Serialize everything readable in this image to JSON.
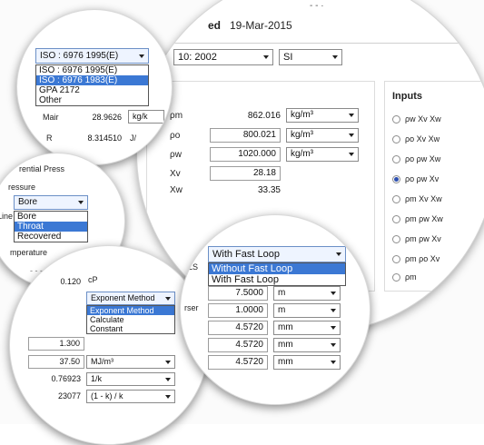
{
  "header": {
    "date_label": "ed",
    "date": "19-Mar-2015",
    "top_fragment": "- - ·"
  },
  "standard_select": {
    "value": "10: 2002"
  },
  "units_select": {
    "value": "SI"
  },
  "measurements": {
    "rows": [
      {
        "label": "ρm",
        "value": "862.016",
        "unit": "kg/m³"
      },
      {
        "label": "ρo",
        "value": "800.021",
        "unit": "kg/m³"
      },
      {
        "label": "ρw",
        "value": "1020.000",
        "unit": "kg/m³"
      },
      {
        "label": "Xv",
        "value": "28.18"
      },
      {
        "label": "Xw",
        "value": "33.35"
      }
    ]
  },
  "inputs": {
    "title": "Inputs",
    "options": [
      {
        "label": "ρw Xv Xw",
        "selected": false
      },
      {
        "label": "ρo Xv Xw",
        "selected": false
      },
      {
        "label": "ρo ρw Xw",
        "selected": false
      },
      {
        "label": "ρo ρw Xv",
        "selected": true
      },
      {
        "label": "ρm Xv Xw",
        "selected": false
      },
      {
        "label": "ρm ρw Xw",
        "selected": false
      },
      {
        "label": "ρm ρw Xv",
        "selected": false
      },
      {
        "label": "ρm ρo Xv",
        "selected": false
      },
      {
        "label": "ρm",
        "selected": false
      }
    ]
  },
  "iso_zoom": {
    "selected": "ISO : 6976 1995(E)",
    "options": [
      {
        "label": "ISO : 6976 1995(E)",
        "highlighted": false
      },
      {
        "label": "ISO : 6976 1983(E)",
        "highlighted": true
      },
      {
        "label": "GPA 2172",
        "highlighted": false
      },
      {
        "label": "Other",
        "highlighted": false
      }
    ],
    "rows": [
      {
        "label": "Mair",
        "value": "28.9626",
        "unit": "kg/k"
      },
      {
        "label": "R",
        "value": "8.314510",
        "unit": "J/"
      }
    ]
  },
  "pressure_zoom": {
    "header": "rential Press",
    "pressure_label": "ressure",
    "selected": "Bore",
    "line_label": "Line",
    "options": [
      {
        "label": "Bore",
        "highlighted": false
      },
      {
        "label": "Throat",
        "highlighted": true
      },
      {
        "label": "Recovered",
        "highlighted": false
      }
    ],
    "temperature_label": "mperature",
    "footer_fragment": "- - -"
  },
  "exponent_zoom": {
    "top_value": "0.120",
    "cp_label": "cP",
    "selected": "Exponent Method",
    "options": [
      {
        "label": "Exponent Method",
        "highlighted": true
      },
      {
        "label": "Calculate",
        "highlighted": false
      },
      {
        "label": "Constant",
        "highlighted": false
      }
    ],
    "rows": [
      {
        "value": "1.300"
      },
      {
        "value": "37.50",
        "unit": "MJ/m³"
      },
      {
        "value": "0.76923",
        "unit": "1/k"
      },
      {
        "value": "23077",
        "unit": "(1 - k) / k"
      }
    ]
  },
  "loop_zoom": {
    "side_label_1": "LS",
    "side_label_2": "rser",
    "selected": "With Fast Loop",
    "options": [
      {
        "label": "Without Fast Loop",
        "highlighted": true
      },
      {
        "label": "With Fast Loop",
        "highlighted": false
      }
    ],
    "rows": [
      {
        "value": "7.5000",
        "unit": "m"
      },
      {
        "value": "1.0000",
        "unit": "m"
      },
      {
        "value": "4.5720",
        "unit": "mm"
      },
      {
        "value": "4.5720",
        "unit": "mm"
      },
      {
        "value": "4.5720",
        "unit": "mm"
      }
    ]
  }
}
